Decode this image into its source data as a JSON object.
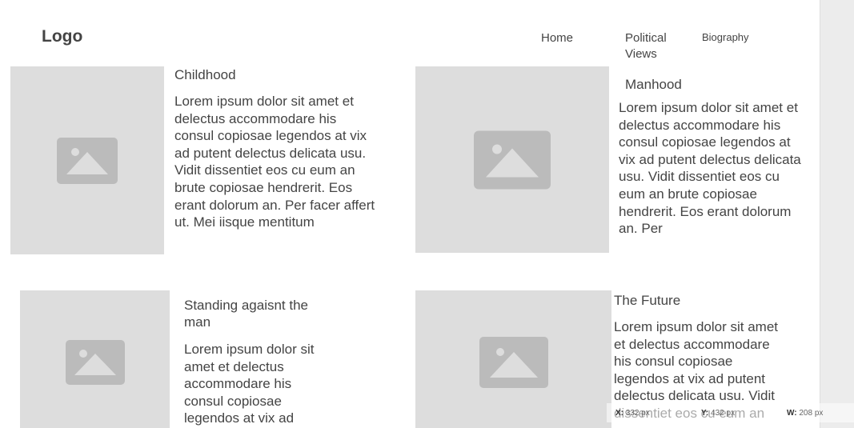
{
  "header": {
    "logo": "Logo",
    "nav": {
      "home": "Home",
      "political_views": "Political Views",
      "biography": "Biography"
    }
  },
  "cards": [
    {
      "title": "Childhood",
      "text": "Lorem ipsum dolor sit amet et delectus accommodare his consul copiosae legendos at vix ad putent delectus delicata usu. Vidit dissentiet eos cu eum an brute copiosae hendrerit. Eos erant dolorum an. Per facer affert ut. Mei iisque mentitum"
    },
    {
      "title": "Manhood",
      "text": "Lorem ipsum dolor sit amet et delectus accommodare his consul copiosae legendos at vix ad putent delectus delicata usu. Vidit dissentiet eos cu eum an brute copiosae hendrerit. Eos erant dolorum an. Per"
    },
    {
      "title": "Standing agaisnt the man",
      "text": "Lorem ipsum dolor sit amet et delectus accommodare his consul copiosae legendos at vix ad"
    },
    {
      "title": "The Future",
      "text": "Lorem ipsum dolor sit amet et delectus accommodare his consul copiosae legendos at vix ad putent delectus delicata usu. Vidit dissentiet eos cu eum an"
    }
  ],
  "icons": {
    "placeholder": "image-placeholder-icon"
  },
  "readout": {
    "x_label": "X:",
    "x_value": "332 px",
    "y_label": "Y:",
    "y_value": "432 px",
    "w_label": "W:",
    "w_value": "208 px"
  },
  "colors": {
    "placeholder_bg": "#dddddd",
    "placeholder_icon": "#bbbbbb",
    "text": "#444444",
    "panel": "#ececec"
  }
}
